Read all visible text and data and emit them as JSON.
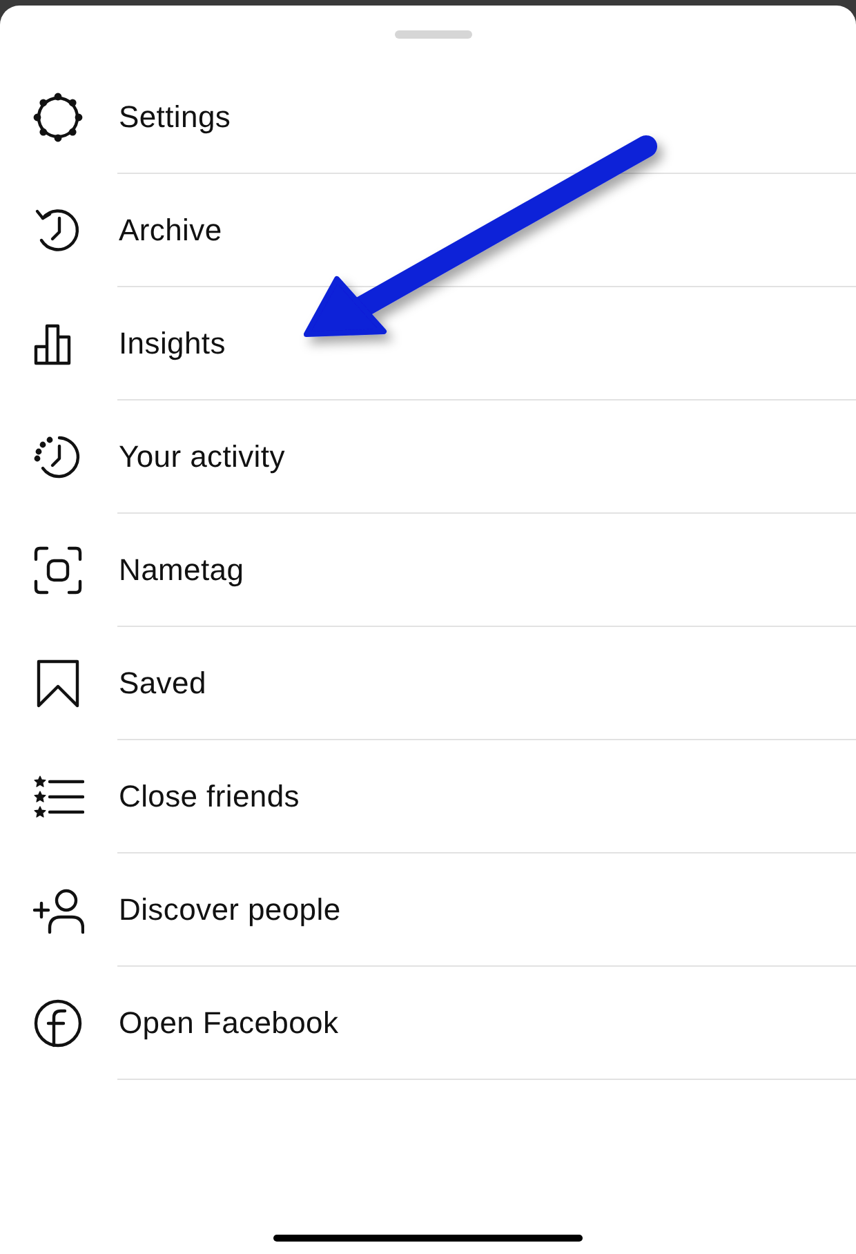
{
  "menu": {
    "items": [
      {
        "label": "Settings"
      },
      {
        "label": "Archive"
      },
      {
        "label": "Insights"
      },
      {
        "label": "Your activity"
      },
      {
        "label": "Nametag"
      },
      {
        "label": "Saved"
      },
      {
        "label": "Close friends"
      },
      {
        "label": "Discover people"
      },
      {
        "label": "Open Facebook"
      }
    ]
  }
}
